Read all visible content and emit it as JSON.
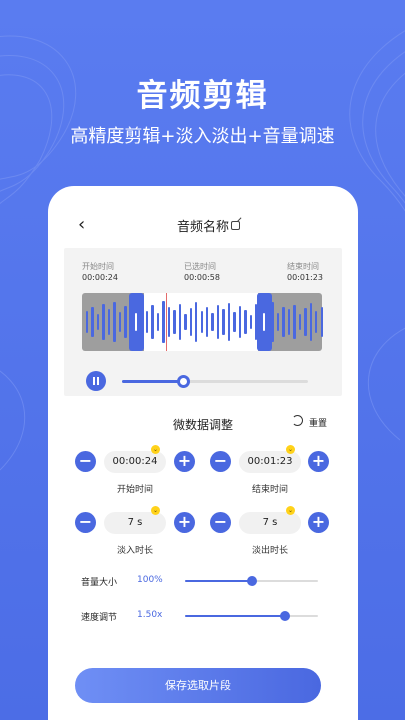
{
  "hero": {
    "title": "音频剪辑",
    "subtitle": "高精度剪辑+淡入淡出+音量调速"
  },
  "nav": {
    "title": "音频名称"
  },
  "timeline": {
    "start_label": "开始时间",
    "start_value": "00:00:24",
    "selected_label": "已选时间",
    "selected_value": "00:00:58",
    "end_label": "结束时间",
    "end_value": "00:01:23",
    "playback_progress": 0.33
  },
  "adjust": {
    "title": "微数据调整",
    "reset_label": "重置",
    "start": {
      "value": "00:00:24",
      "label": "开始时间"
    },
    "end": {
      "value": "00:01:23",
      "label": "结束时间"
    },
    "fade_in": {
      "value": "7 s",
      "label": "淡入时长"
    },
    "fade_out": {
      "value": "7 s",
      "label": "淡出时长"
    },
    "minus_symbol": "−",
    "plus_symbol": "+"
  },
  "sliders": {
    "volume": {
      "label": "音量大小",
      "value": "100%",
      "level": 0.5
    },
    "speed": {
      "label": "速度调节",
      "value": "1.50x",
      "level": 0.75
    }
  },
  "save_label": "保存选取片段",
  "colors": {
    "accent": "#4a68e0",
    "background": "#5a7cf0",
    "badge": "#ffd21a"
  }
}
